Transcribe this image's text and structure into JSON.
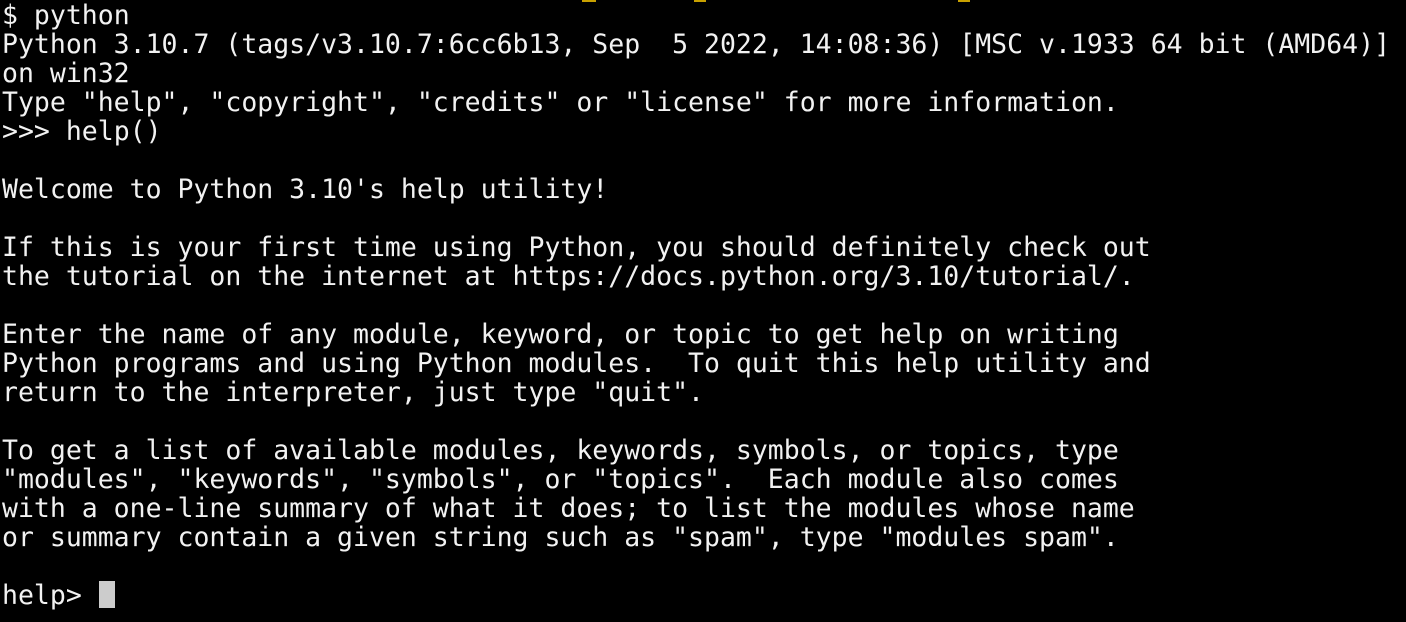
{
  "terminal": {
    "shell_prompt": "$ ",
    "shell_command": "python",
    "banner": [
      "Python 3.10.7 (tags/v3.10.7:6cc6b13, Sep  5 2022, 14:08:36) [MSC v.1933 64 bit (AMD64)]",
      "on win32",
      "Type \"help\", \"copyright\", \"credits\" or \"license\" for more information."
    ],
    "repl_prompt": ">>> ",
    "repl_input": "help()",
    "help_text": [
      "Welcome to Python 3.10's help utility!",
      "If this is your first time using Python, you should definitely check out",
      "the tutorial on the internet at https://docs.python.org/3.10/tutorial/.",
      "Enter the name of any module, keyword, or topic to get help on writing",
      "Python programs and using Python modules.  To quit this help utility and",
      "return to the interpreter, just type \"quit\".",
      "To get a list of available modules, keywords, symbols, or topics, type",
      "\"modules\", \"keywords\", \"symbols\", or \"topics\".  Each module also comes",
      "with a one-line summary of what it does; to list the modules whose name",
      "or summary contain a given string such as \"spam\", type \"modules spam\"."
    ],
    "help_prompt": "help> "
  },
  "colors": {
    "background": "#000000",
    "foreground": "#f2f2f2",
    "cursor": "#cccccc"
  }
}
